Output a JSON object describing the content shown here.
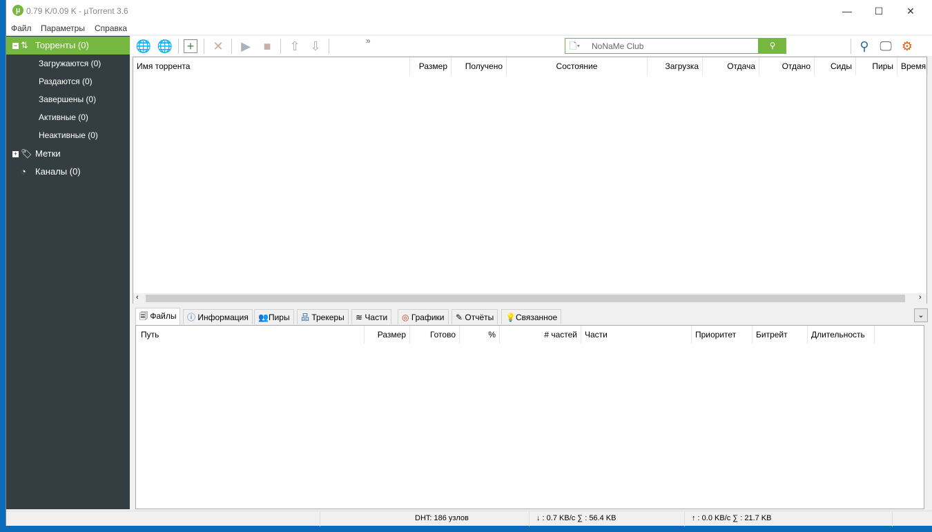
{
  "window": {
    "title": "0.79 K/0.09 K - µTorrent 3.6",
    "minimize": "—",
    "maximize": "☐",
    "close": "✕"
  },
  "menu": [
    "Файл",
    "Параметры",
    "Справка"
  ],
  "sidebar": {
    "torrents": "Торренты (0)",
    "items": [
      "Загружаются (0)",
      "Раздаются (0)",
      "Завершены (0)",
      "Активные (0)",
      "Неактивные (0)"
    ],
    "labels": "Метки",
    "feeds": "Каналы (0)"
  },
  "toolbar": {
    "more": "»",
    "search_placeholder": "NoNaMe Club"
  },
  "torrent_columns": [
    "Имя торрента",
    "Размер",
    "Получено",
    "Состояние",
    "Загрузка",
    "Отдача",
    "Отдано",
    "Сиды",
    "Пиры",
    "Время"
  ],
  "tabs": [
    "Файлы",
    "Информация",
    "Пиры",
    "Трекеры",
    "Части",
    "Графики",
    "Отчёты",
    "Связанное"
  ],
  "file_columns": [
    "Путь",
    "Размер",
    "Готово",
    "%",
    "# частей",
    "Части",
    "Приоритет",
    "Битрейт",
    "Длительность"
  ],
  "status": {
    "dht": "DHT: 186 узлов",
    "down": "↓ : 0.7 KB/c  ∑ : 56.4 KB",
    "up": "↑ : 0.0 KB/c  ∑ : 21.7 KB"
  },
  "colors": {
    "accent": "#76b83f",
    "sidebar": "#333d42"
  }
}
